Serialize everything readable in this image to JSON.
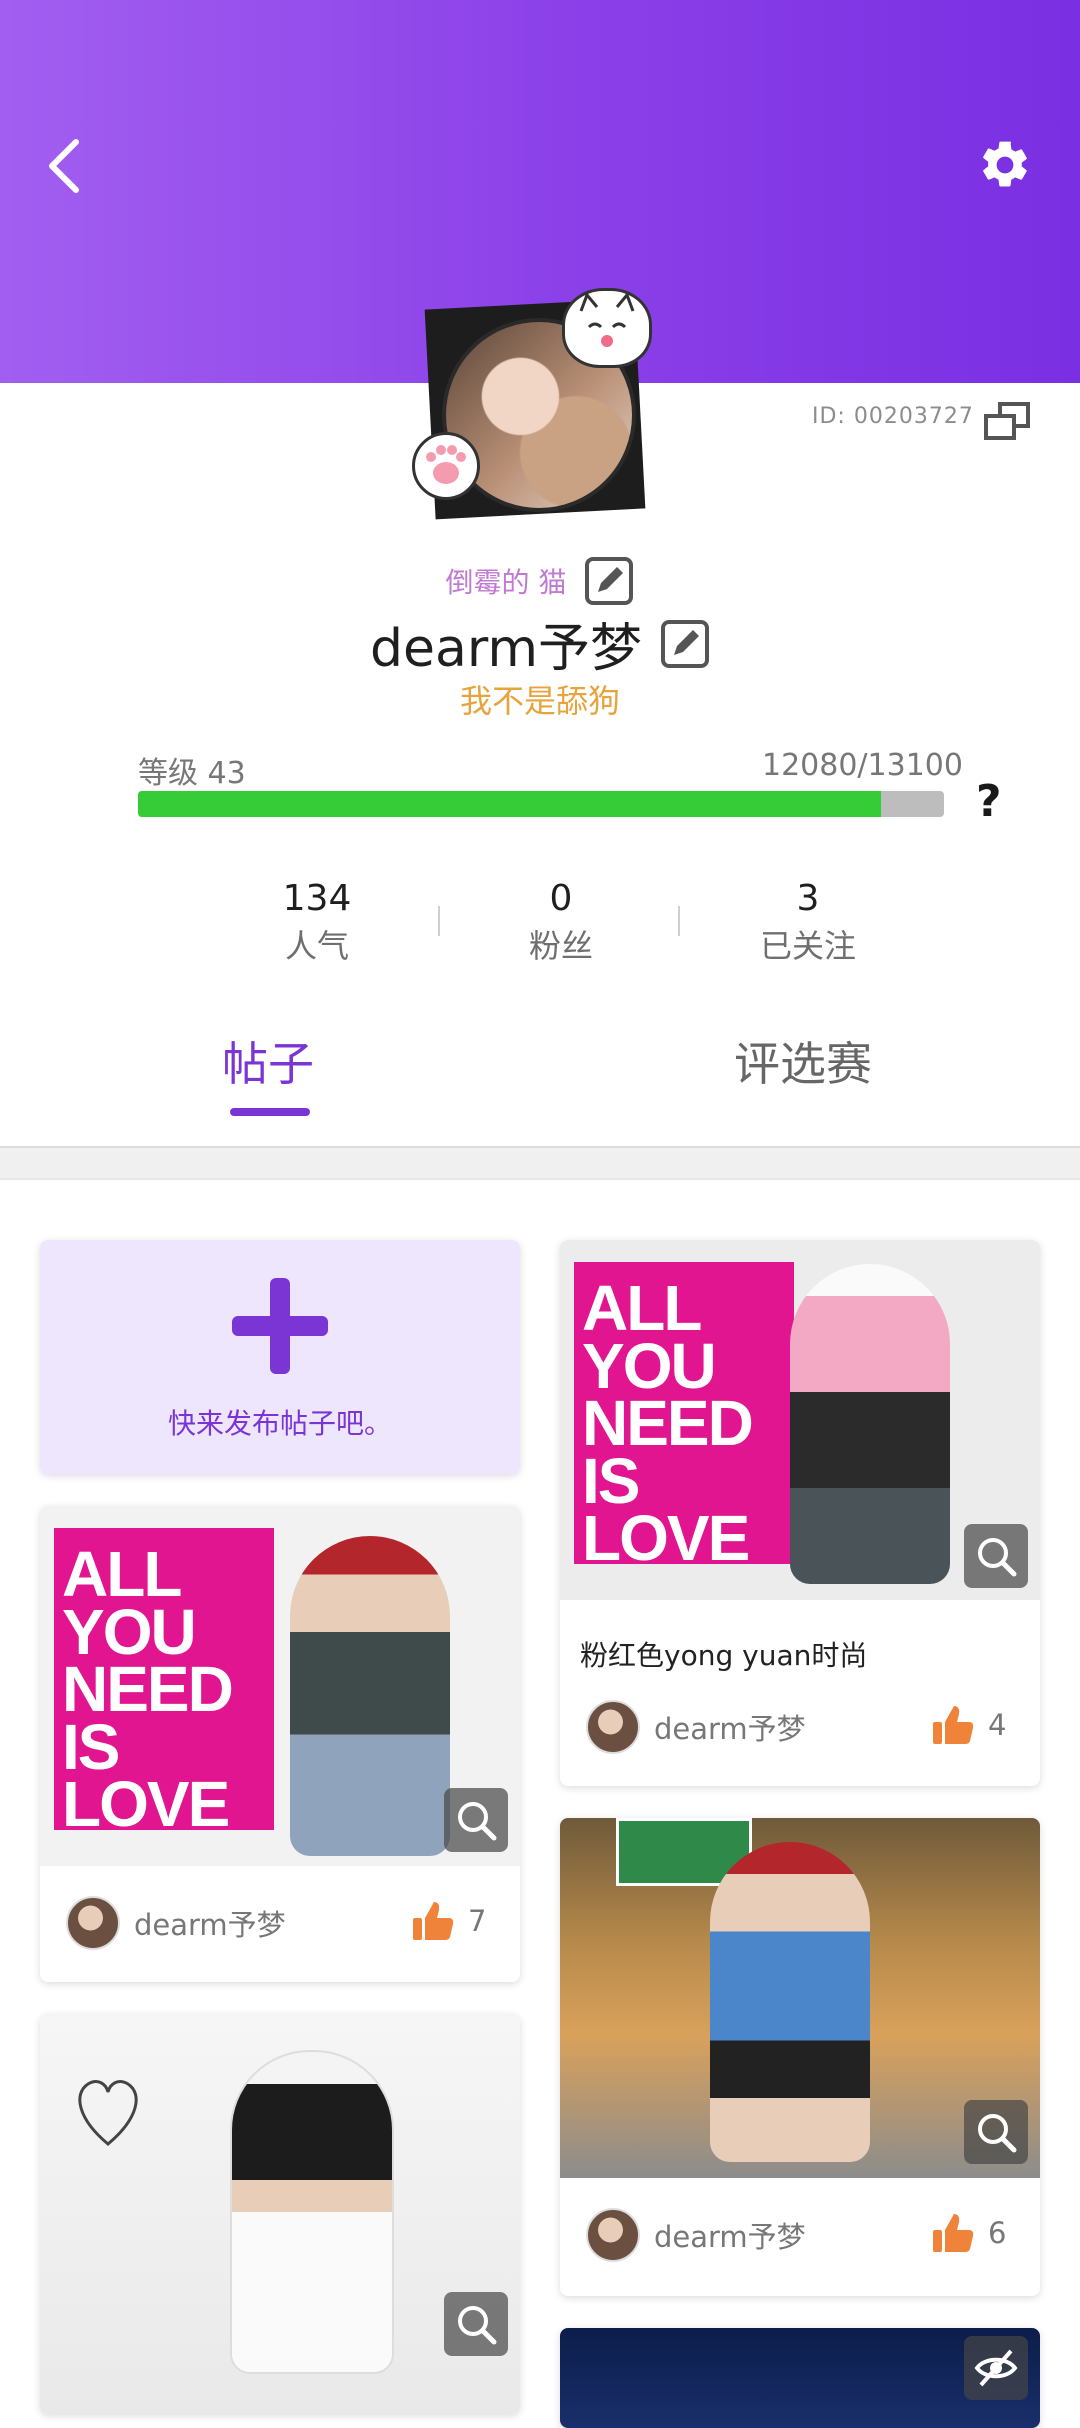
{
  "profile": {
    "id_text": "ID: 00203727",
    "nickname_title": "倒霉的 猫",
    "username": "dearm予梦",
    "signature": "我不是舔狗"
  },
  "level": {
    "label": "等级 43",
    "exp_text": "12080/13100",
    "progress_fraction": 0.922,
    "help": "?"
  },
  "stats": [
    {
      "value": "134",
      "label": "人气"
    },
    {
      "value": "0",
      "label": "粉丝"
    },
    {
      "value": "3",
      "label": "已关注"
    }
  ],
  "tabs": [
    {
      "label": "帖子",
      "active": true
    },
    {
      "label": "评选赛",
      "active": false
    }
  ],
  "create_post": {
    "text": "快来发布帖子吧。"
  },
  "posts": [
    {
      "title": "",
      "author": "dearm予梦",
      "likes": "7",
      "poster_text": "ALL\nYOU\nNEED\nIS\nLOVE"
    },
    {
      "title": "",
      "author": "",
      "likes": ""
    },
    {
      "title": "粉红色yong yuan时尚",
      "author": "dearm予梦",
      "likes": "4",
      "poster_text": "ALL\nYOU\nNEED\nIS\nLOVE"
    },
    {
      "title": "",
      "author": "dearm予梦",
      "likes": "6"
    }
  ],
  "colors": {
    "accent": "#7b35d5",
    "header_start": "#a25ef0",
    "header_end": "#7a2fe2",
    "progress": "#35cc37",
    "signature": "#e8a43c",
    "like": "#f0833a"
  },
  "icons": {
    "back": "chevron-left-icon",
    "settings": "gear-icon",
    "copy": "copy-icon",
    "edit": "edit-icon",
    "plus": "plus-icon",
    "zoom": "zoom-icon",
    "like": "thumbs-up-icon",
    "hidden": "eye-off-icon"
  }
}
